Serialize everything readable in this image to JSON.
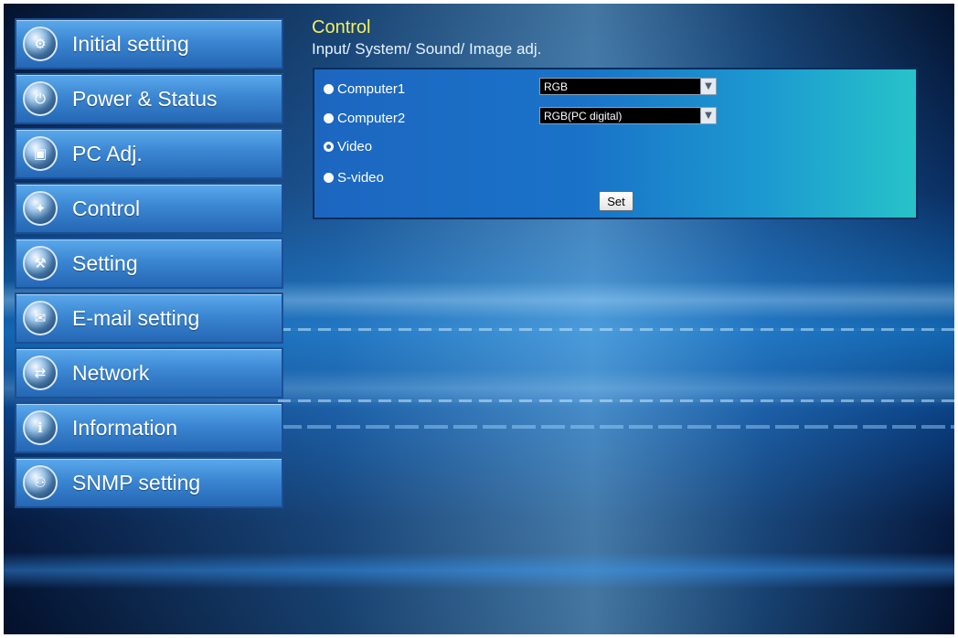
{
  "sidebar": {
    "items": [
      {
        "label": "Initial setting"
      },
      {
        "label": "Power & Status"
      },
      {
        "label": "PC Adj."
      },
      {
        "label": "Control"
      },
      {
        "label": "Setting"
      },
      {
        "label": "E-mail setting"
      },
      {
        "label": "Network"
      },
      {
        "label": "Information"
      },
      {
        "label": "SNMP setting"
      }
    ]
  },
  "main": {
    "title": "Control",
    "subtitle": "Input/ System/ Sound/ Image adj.",
    "inputs": [
      {
        "label": "Computer1",
        "selected": false,
        "select_value": "RGB"
      },
      {
        "label": "Computer2",
        "selected": false,
        "select_value": "RGB(PC digital)"
      },
      {
        "label": "Video",
        "selected": true
      },
      {
        "label": "S-video",
        "selected": false
      }
    ],
    "set_button": "Set"
  },
  "colors": {
    "title": "#f4ef5a",
    "nav_button": "#3b86d2",
    "panel": "#1a73c8",
    "panel_edge": "#27c3c9"
  }
}
